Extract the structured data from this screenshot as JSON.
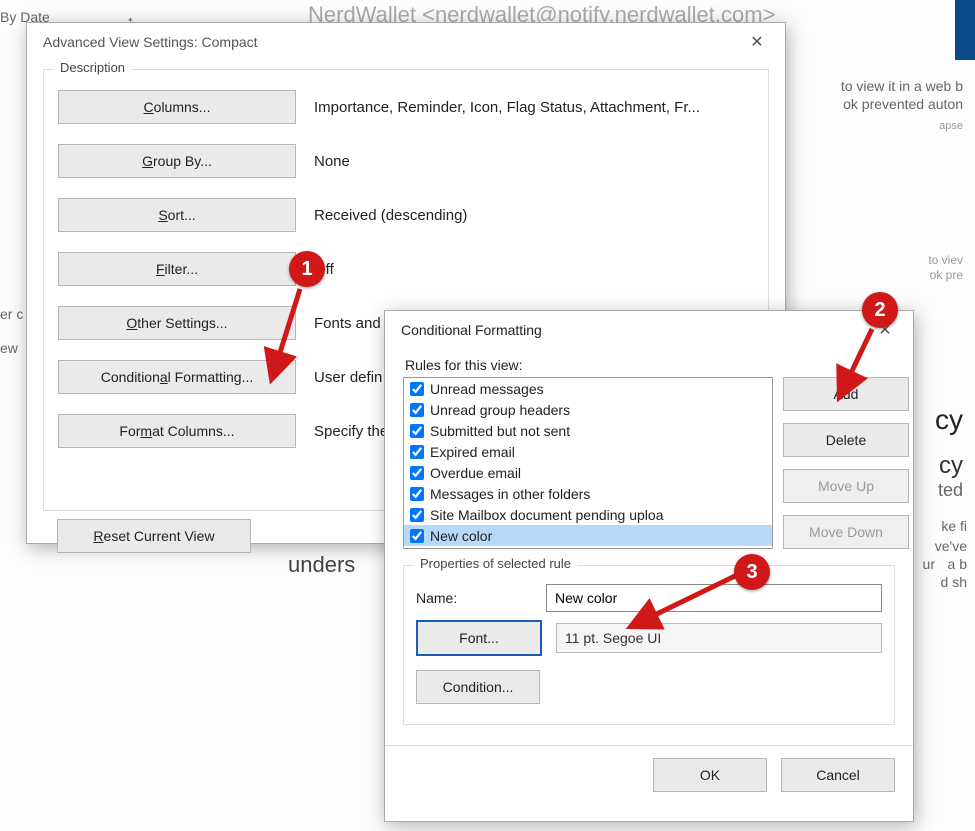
{
  "background": {
    "byDate": "By Date",
    "sender": "NerdWallet <nerdwallet@notify.nerdwallet.com>",
    "l1": "to view it in a web b",
    "l2": "ok prevented auton",
    "l3": "to viev",
    "l4": "ok pre",
    "side_er": "er c",
    "side_ew": "ew",
    "frag_cy": "cy",
    "frag_cy2": "cy",
    "frag_ted": "ted",
    "frag_ke": "ke fi",
    "frag_ve": "ve've",
    "frag_ab": "a b",
    "frag_ds": "d sh",
    "apse": "apse",
    "understand": "unders",
    "ur": "ur"
  },
  "avs": {
    "title": "Advanced View Settings: Compact",
    "group_legend": "Description",
    "rows": {
      "columns": {
        "btn_pre": "",
        "btn_u": "C",
        "btn_post": "olumns...",
        "desc": "Importance, Reminder, Icon, Flag Status, Attachment, Fr..."
      },
      "groupby": {
        "btn_pre": "",
        "btn_u": "G",
        "btn_post": "roup By...",
        "desc": "None"
      },
      "sort": {
        "btn_pre": "",
        "btn_u": "S",
        "btn_post": "ort...",
        "desc": "Received (descending)"
      },
      "filter": {
        "btn_pre": "",
        "btn_u": "F",
        "btn_post": "ilter...",
        "desc": "Off"
      },
      "other": {
        "btn_pre": "",
        "btn_u": "O",
        "btn_post": "ther Settings...",
        "desc": "Fonts and"
      },
      "condfmt": {
        "btn_pre": "Condition",
        "btn_u": "a",
        "btn_post": "l Formatting...",
        "desc": "User defin"
      },
      "fmtcols": {
        "btn_pre": "For",
        "btn_u": "m",
        "btn_post": "at Columns...",
        "desc": "Specify the"
      },
      "reset": {
        "btn_pre": "",
        "btn_u": "R",
        "btn_post": "eset Current View"
      }
    }
  },
  "cf": {
    "title": "Conditional Formatting",
    "rules_label": "Rules for this view:",
    "rules": [
      {
        "label": "Unread messages",
        "checked": true,
        "selected": false
      },
      {
        "label": "Unread group headers",
        "checked": true,
        "selected": false
      },
      {
        "label": "Submitted but not sent",
        "checked": true,
        "selected": false
      },
      {
        "label": "Expired email",
        "checked": true,
        "selected": false
      },
      {
        "label": "Overdue email",
        "checked": true,
        "selected": false
      },
      {
        "label": "Messages in other folders",
        "checked": true,
        "selected": false
      },
      {
        "label": "Site Mailbox document pending uploa",
        "checked": true,
        "selected": false
      },
      {
        "label": "New color",
        "checked": true,
        "selected": true
      }
    ],
    "buttons": {
      "add": "Add",
      "delete": "Delete",
      "moveup": "Move Up",
      "movedown": "Move Down",
      "ok": "OK",
      "cancel": "Cancel"
    },
    "props": {
      "legend": "Properties of selected rule",
      "name_label": "Name:",
      "name_value": "New color",
      "font_btn": "Font...",
      "font_sample": "11 pt. Segoe UI",
      "cond_btn": "Condition..."
    }
  },
  "annotations": {
    "1": "1",
    "2": "2",
    "3": "3"
  }
}
